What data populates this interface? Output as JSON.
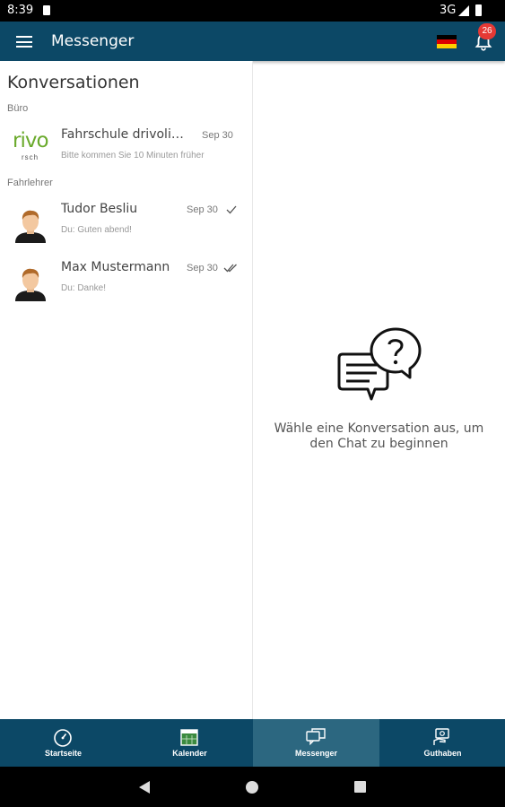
{
  "status_bar": {
    "time": "8:39",
    "network": "3G"
  },
  "app_bar": {
    "title": "Messenger",
    "notification_count": "26"
  },
  "conversations": {
    "title": "Konversationen",
    "sections": [
      {
        "label": "Büro"
      },
      {
        "label": "Fahrlehrer"
      }
    ],
    "items": [
      {
        "name": "Fahrschule drivolino",
        "preview": "Bitte kommen Sie 10 Minuten früher",
        "date": "Sep 30",
        "logo_text": "rivo",
        "logo_sub": "rsch"
      },
      {
        "name": "Tudor Besliu",
        "preview": "Du: Guten abend!",
        "date": "Sep 30",
        "status": "sent"
      },
      {
        "name": "Max Mustermann",
        "preview": "Du: Danke!",
        "date": "Sep 30",
        "status": "read"
      }
    ]
  },
  "empty_state": {
    "text": "Wähle eine Konversation aus, um den Chat zu beginnen"
  },
  "bottom_nav": [
    {
      "label": "Startseite",
      "icon": "speedometer-icon"
    },
    {
      "label": "Kalender",
      "icon": "calendar-icon"
    },
    {
      "label": "Messenger",
      "icon": "chat-icon",
      "active": true
    },
    {
      "label": "Guthaben",
      "icon": "wallet-icon"
    }
  ],
  "colors": {
    "primary": "#0c4866",
    "active_tab": "#2c6780",
    "badge": "#e53935",
    "logo_green": "#6aaa2c"
  }
}
